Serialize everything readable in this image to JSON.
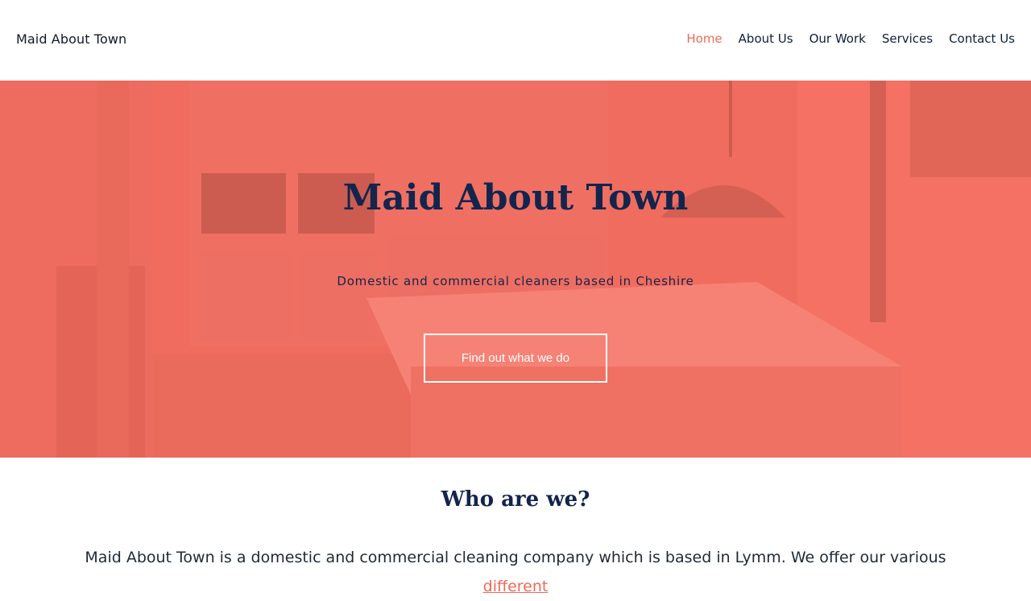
{
  "header": {
    "brand": "Maid About Town",
    "nav": [
      {
        "label": "Home",
        "active": true
      },
      {
        "label": "About Us",
        "active": false
      },
      {
        "label": "Our Work",
        "active": false
      },
      {
        "label": "Services",
        "active": false
      },
      {
        "label": "Contact Us",
        "active": false
      }
    ]
  },
  "hero": {
    "title": "Maid About Town",
    "subtitle": "Domestic and commercial cleaners based in Cheshire",
    "cta_label": "Find out what we do",
    "overlay_color": "#ff6e5f"
  },
  "about": {
    "heading": "Who are we?",
    "text_before_link": "Maid About Town is a domestic and commercial cleaning company which is based in Lymm. We offer our various ",
    "link_label": "different"
  },
  "colors": {
    "accent": "#ef6a57",
    "navy": "#13254d"
  }
}
